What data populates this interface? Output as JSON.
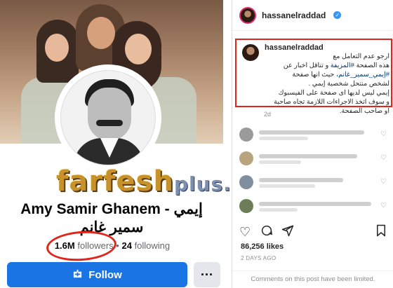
{
  "facebook": {
    "page_name": "Amy Samir Ghanem - إيمي سمير غانم",
    "followers_count": "1.6M",
    "followers_label": "followers",
    "separator": "•",
    "following_count": "24",
    "following_label": "following",
    "follow_button_label": "Follow",
    "more_button_label": "···",
    "accent_color": "#1b74e4",
    "annotation_color": "#e0251b"
  },
  "watermark": {
    "text": "farfesh",
    "suffix": "plus.com"
  },
  "instagram": {
    "header_username": "hassanelraddad",
    "caption": {
      "username": "hassanelraddad",
      "line1": "ارجو عدم التعامل مع",
      "line2_a": "هذه الصفحة ",
      "hashtag1": "#المزيفة",
      "line2_b": " و تناقل اخبار عن",
      "hashtag2": "#إيمي_سمير_غانم،",
      "line3_b": " حيث انها صفحة",
      "line4": "لشخص منتحل شخصية إيمي .",
      "line5": "إيمي ليس لديها اى صفحة على الفيسبوك",
      "line6": "و سوف اتخذ الاجراءات اللازمة تجاه صاحبة",
      "line7": "او صاحب الصفحة."
    },
    "caption_time": "2d",
    "likes": "86,256 likes",
    "posted": "2 DAYS AGO",
    "limited_notice": "Comments on this post have been limited.",
    "icons": [
      "heart-icon",
      "comment-icon",
      "share-icon",
      "bookmark-icon"
    ]
  }
}
